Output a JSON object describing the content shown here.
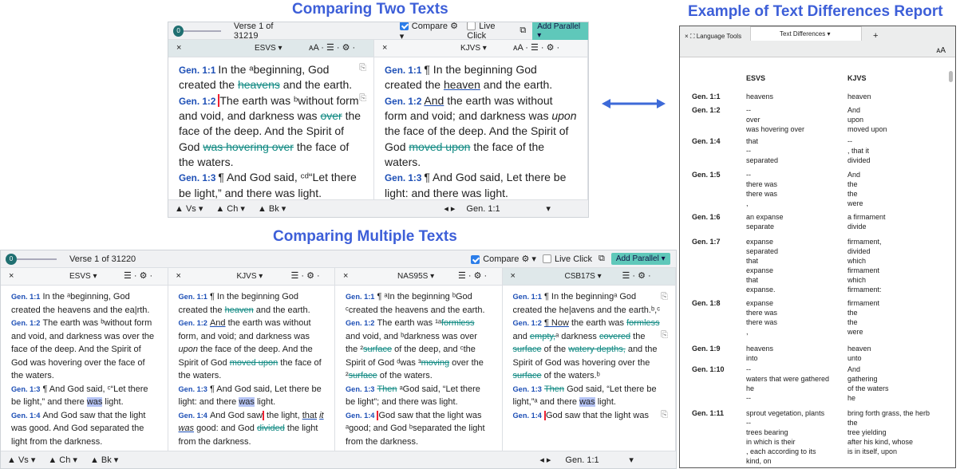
{
  "titles": {
    "compare_two": "Comparing Two Texts",
    "compare_multi": "Comparing Multiple Texts",
    "report": "Example of Text Differences Report"
  },
  "colors": {
    "title": "#3d5fd8",
    "accent": "#5fc8ba",
    "link": "#1d4fb6",
    "diff": "#148b84"
  },
  "two": {
    "slider_val": "0",
    "verse": "Verse 1 of 31219",
    "compare": "Compare",
    "live": "Live Click",
    "add": "Add Parallel",
    "tabs": [
      {
        "name": "ESVS",
        "x": "×",
        "tools": "ᴀA · ☰ · ⚙ ·"
      },
      {
        "name": "KJVS",
        "x": "×",
        "tools": "ᴀA · ☰ · ⚙ ·"
      }
    ],
    "bottom": {
      "vs": "▲ Vs ▾",
      "ch": "▲ Ch ▾",
      "bk": "▲ Bk ▾",
      "ref": "Gen. 1:1"
    }
  },
  "multi": {
    "slider_val": "0",
    "verse": "Verse 1 of 31220",
    "compare": "Compare",
    "live": "Live Click",
    "add": "Add Parallel",
    "tabs": [
      "ESVS",
      "KJVS",
      "NAS95S",
      "CSB17S"
    ],
    "bottom": {
      "vs": "▲ Vs ▾",
      "ch": "▲ Ch ▾",
      "bk": "▲ Bk ▾",
      "ref": "Gen. 1:1"
    }
  },
  "report": {
    "tab1": "Language Tools",
    "tab2": "Text Differences",
    "plus": "+",
    "aa": "ᴀA",
    "col_e": "ESVS",
    "col_k": "KJVS",
    "rows": [
      {
        "ref": "Gen. 1:1",
        "e": "heavens",
        "k": "heaven"
      },
      {
        "ref": "Gen. 1:2",
        "e": "--\nover\nwas hovering over",
        "k": "And\nupon\nmoved upon"
      },
      {
        "ref": "Gen. 1:4",
        "e": "that\n--\nseparated",
        "k": "--\n, that it\ndivided"
      },
      {
        "ref": "Gen. 1:5",
        "e": "--\nthere was\nthere was\n,",
        "k": "And\nthe\nthe\nwere"
      },
      {
        "ref": "Gen. 1:6",
        "e": "an expanse\nseparate",
        "k": "a firmament\ndivide"
      },
      {
        "ref": "Gen. 1:7",
        "e": "expanse\nseparated\nthat\nexpanse\nthat\nexpanse.",
        "k": "firmament,\ndivided\nwhich\nfirmament\nwhich\nfirmament:"
      },
      {
        "ref": "Gen. 1:8",
        "e": "expanse\nthere was\nthere was\n,",
        "k": "firmament\nthe\nthe\nwere"
      },
      {
        "ref": "Gen. 1:9",
        "e": "heavens\ninto",
        "k": "heaven\nunto"
      },
      {
        "ref": "Gen. 1:10",
        "e": "--\nwaters that were gathered\nhe\n--",
        "k": "And\ngathering\nof the waters\nhe"
      },
      {
        "ref": "Gen. 1:11",
        "e": "sprout vegetation, plants\n--\ntrees bearing\nin which is their\n, each according to its\nkind, on",
        "k": "bring forth grass, the herb\nthe\ntree yielding\nafter his kind, whose\nis in itself, upon"
      }
    ]
  }
}
